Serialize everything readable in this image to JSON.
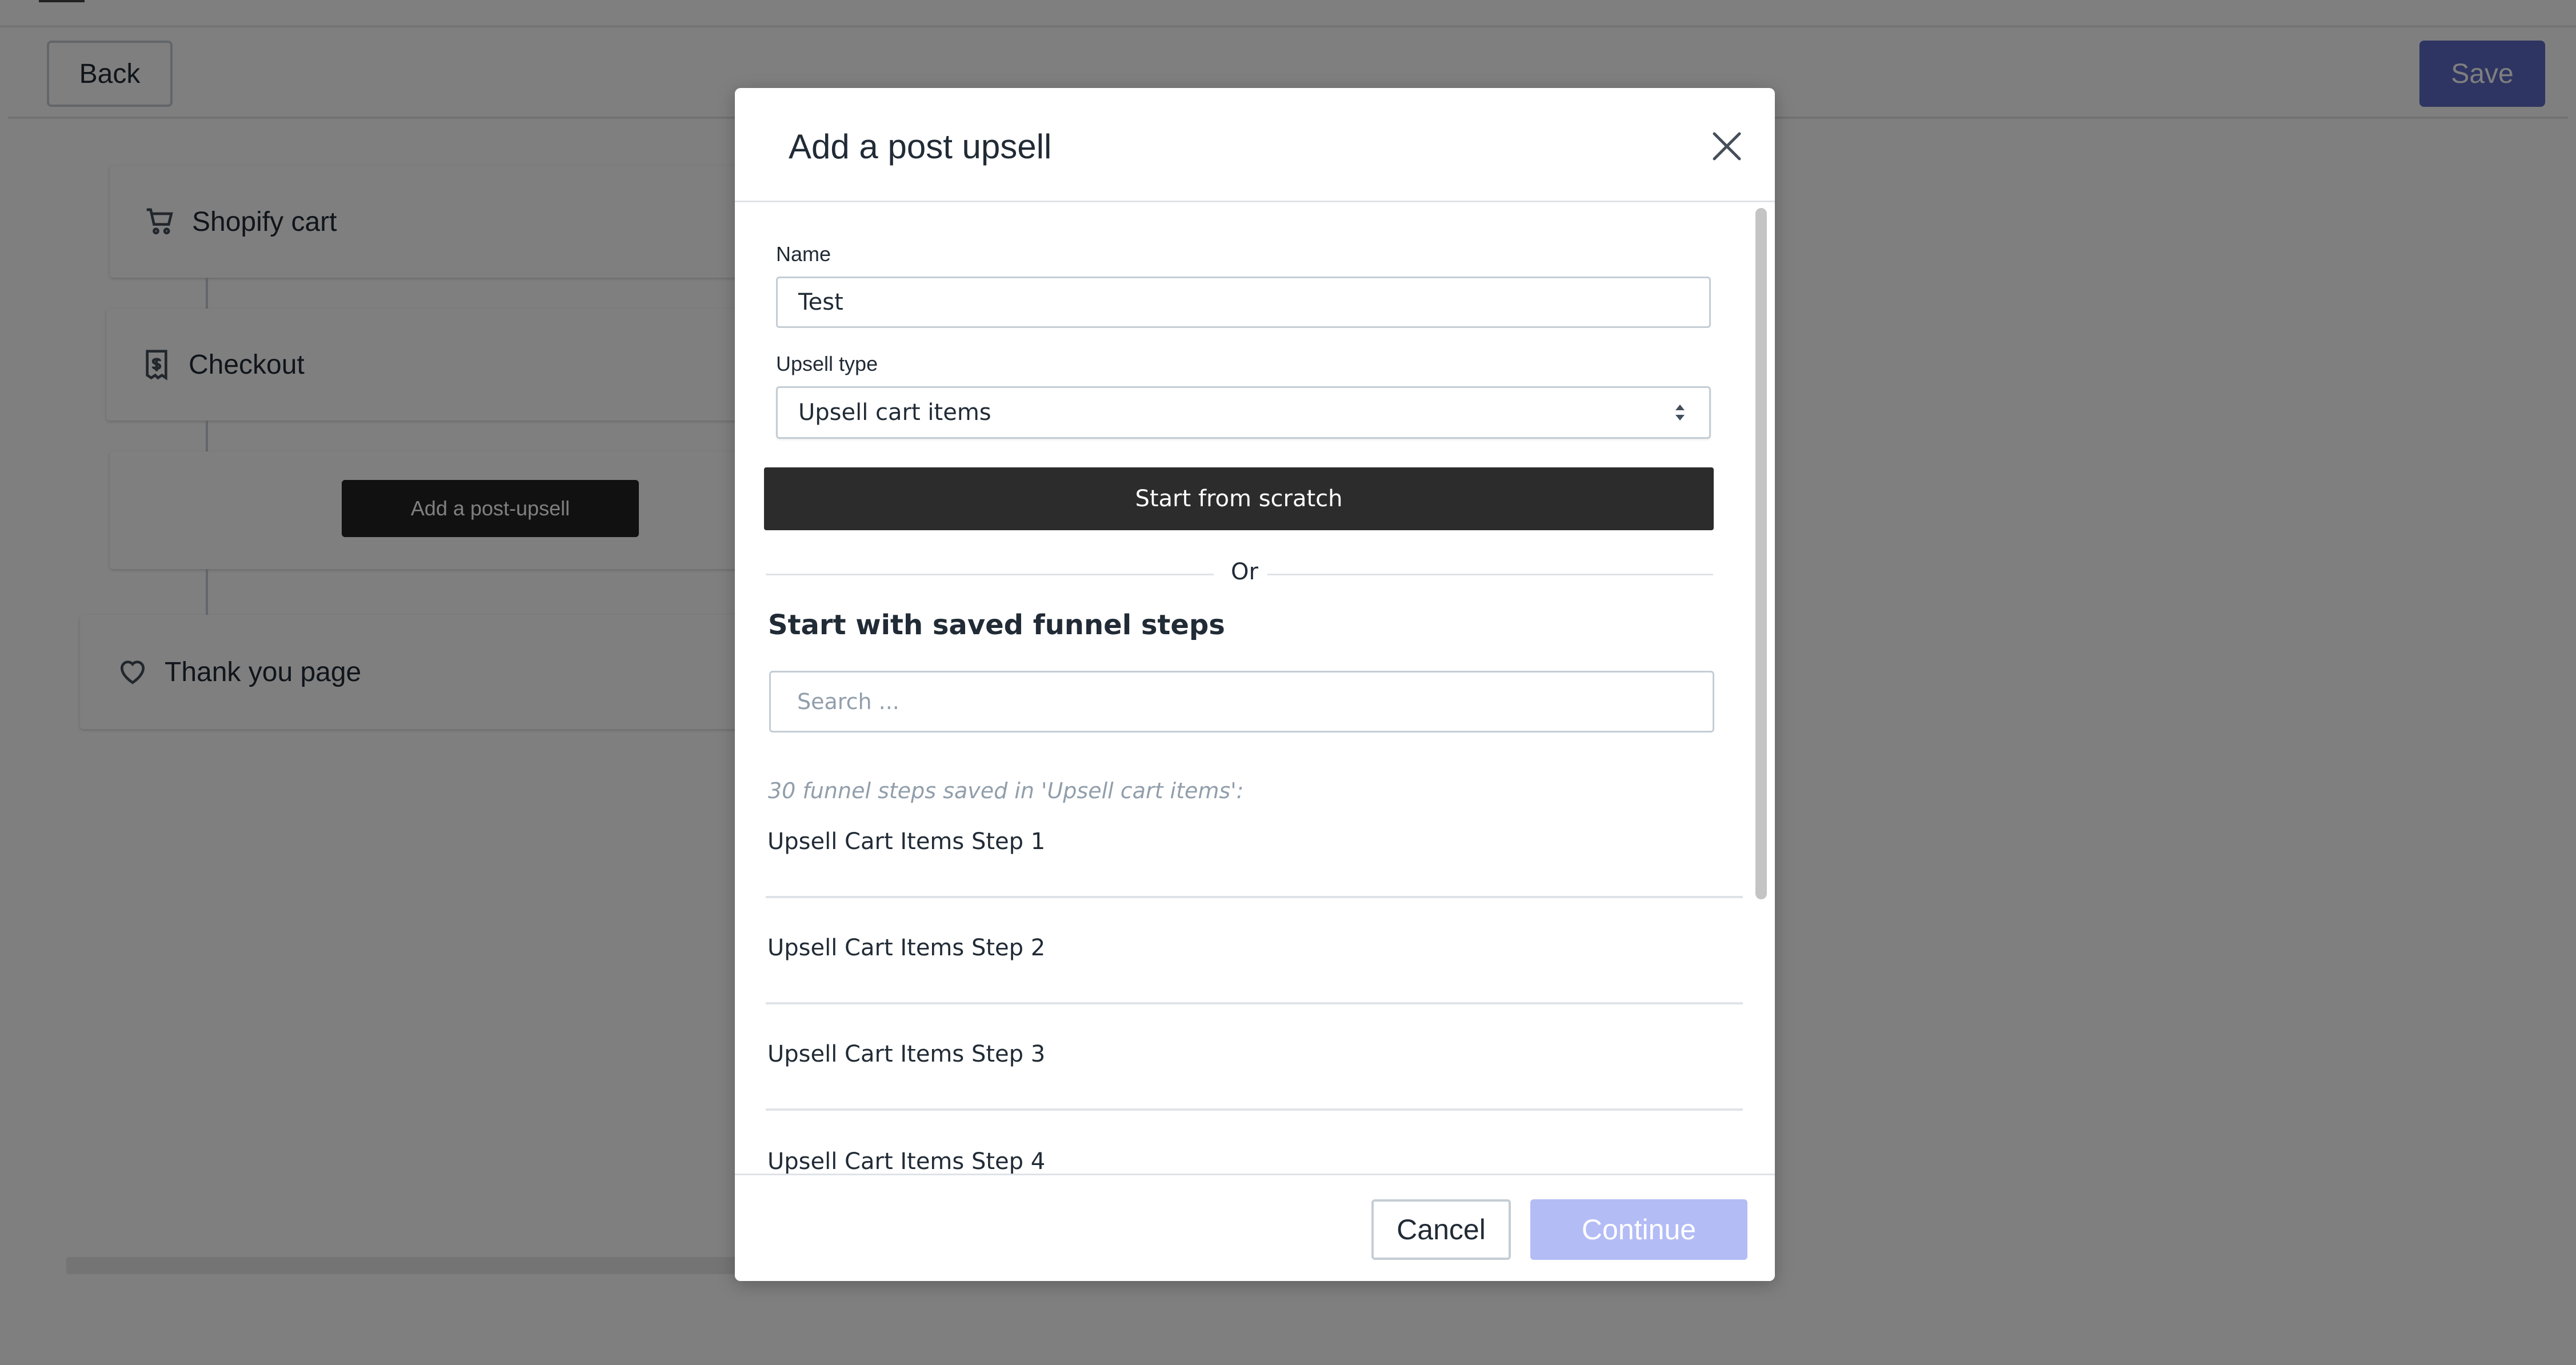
{
  "toolbar": {
    "back_label": "Back",
    "save_label": "Save"
  },
  "funnel": {
    "steps": [
      {
        "label": "Shopify cart",
        "icon": "cart-icon"
      },
      {
        "label": "Checkout",
        "icon": "receipt-icon"
      },
      {
        "label": "Thank you page",
        "icon": "heart-icon"
      }
    ],
    "add_post_upsell_label": "Add a post-upsell"
  },
  "modal": {
    "title": "Add a post upsell",
    "name_label": "Name",
    "name_value": "Test",
    "upsell_type_label": "Upsell type",
    "upsell_type_value": "Upsell cart items",
    "start_scratch_label": "Start from scratch",
    "or_text": "Or",
    "saved_section_title": "Start with saved funnel steps",
    "search_placeholder": "Search ...",
    "saved_count_text": "30  funnel steps saved  in 'Upsell cart items':",
    "saved_steps": [
      "Upsell Cart Items Step 1",
      "Upsell Cart Items Step 2",
      "Upsell Cart Items Step 3",
      "Upsell Cart Items Step 4"
    ],
    "cancel_label": "Cancel",
    "continue_label": "Continue"
  },
  "colors": {
    "primary_disabled": "#b3bcf5",
    "save_primary": "#5c6ac4",
    "dark_button": "#2c2c2c",
    "overlay": "rgba(0,0,0,0.5)"
  }
}
